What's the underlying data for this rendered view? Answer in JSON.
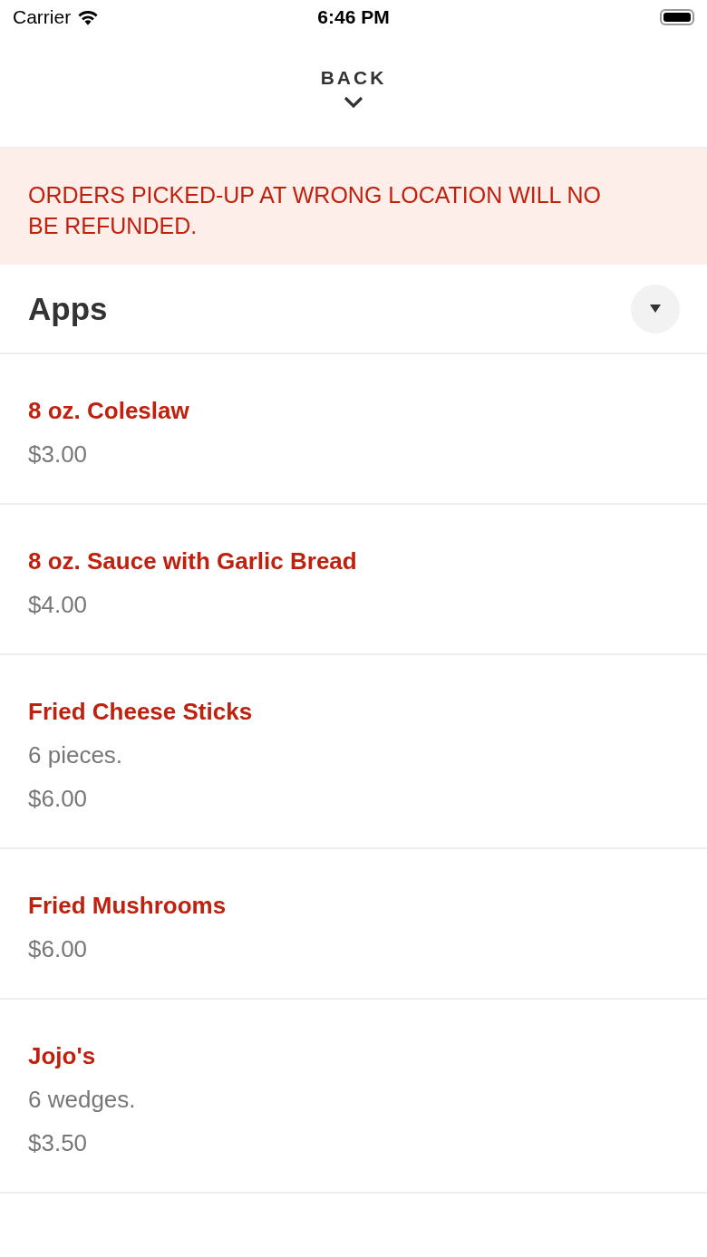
{
  "status_bar": {
    "carrier": "Carrier",
    "time": "6:46 PM"
  },
  "nav": {
    "back_label": "BACK"
  },
  "notice": {
    "lines": [
      "ORDERS PICKED-UP AT WRONG LOCATION WILL NO",
      "BE REFUNDED."
    ]
  },
  "section": {
    "title": "Apps"
  },
  "items": [
    {
      "name": "8 oz. Coleslaw",
      "price": "$3.00"
    },
    {
      "name": "8 oz. Sauce with Garlic Bread",
      "price": "$4.00"
    },
    {
      "name": "Fried Cheese Sticks",
      "description": "6 pieces.",
      "price": "$6.00"
    },
    {
      "name": "Fried Mushrooms",
      "price": "$6.00"
    },
    {
      "name": "Jojo's",
      "description": "6 wedges.",
      "price": "$3.50"
    }
  ]
}
